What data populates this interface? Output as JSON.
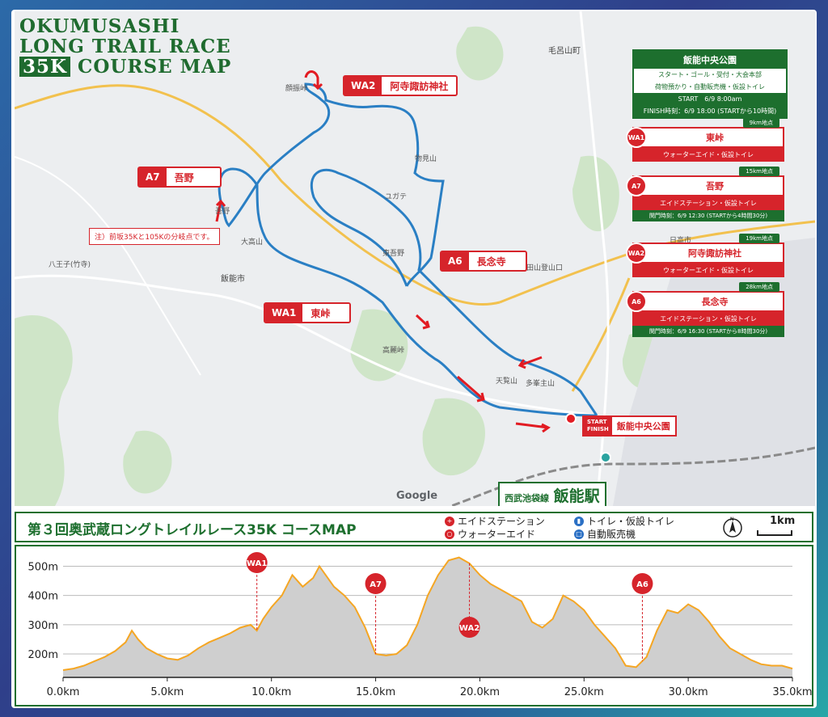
{
  "title": {
    "line1": "OKUMUSASHI",
    "line2": "LONG TRAIL RACE",
    "line3_badge": "35K",
    "line3_rest": "COURSE MAP"
  },
  "colors": {
    "accent_red": "#d6242b",
    "green": "#1d6f2e",
    "route": "#2a7fc4",
    "profile_line": "#f5a623",
    "profile_fill": "#cfcfcf"
  },
  "callouts": {
    "a7": {
      "tag": "A7",
      "name": "吾野"
    },
    "wa2": {
      "tag": "WA2",
      "name": "阿寺諏訪神社"
    },
    "a6": {
      "tag": "A6",
      "name": "長念寺"
    },
    "wa1": {
      "tag": "WA1",
      "name": "東峠"
    }
  },
  "note": "注）前坂35Kと105Kの分岐点です。",
  "start_finish": {
    "tag_line1": "START",
    "tag_line2": "FINISH",
    "name": "飯能中央公園"
  },
  "station": {
    "small": "西武池袋線",
    "big": "飯能駅"
  },
  "info_main": {
    "title": "飯能中央公園",
    "line1": "スタート・ゴール・受付・大会本部",
    "line2": "荷物預かり・自動販売機・仮設トイレ",
    "start": "START　6/9  8:00am",
    "finish": "FINISH時刻：6/9 18:00 (STARTから10時間)"
  },
  "info_items": [
    {
      "dist": "9km地点",
      "badge": "WA1",
      "name": "東峠",
      "desc": "ウォーターエイド・仮設トイレ",
      "closing": ""
    },
    {
      "dist": "15km地点",
      "badge": "A7",
      "name": "吾野",
      "desc": "エイドステーション・仮設トイレ",
      "closing": "関門時刻：6/9 12:30 (STARTから4時間30分)"
    },
    {
      "dist": "19km地点",
      "badge": "WA2",
      "name": "阿寺諏訪神社",
      "desc": "ウォーターエイド・仮設トイレ",
      "closing": ""
    },
    {
      "dist": "28km地点",
      "badge": "A6",
      "name": "長念寺",
      "desc": "エイドステーション・仮設トイレ",
      "closing": "関門時刻：6/9 16:30 (STARTから8時間30分)"
    }
  ],
  "map_labels": [
    {
      "t": "飯能市"
    },
    {
      "t": "毛呂山町"
    },
    {
      "t": "日高市"
    },
    {
      "t": "顔振峠"
    },
    {
      "t": "大高山"
    },
    {
      "t": "天覧山"
    },
    {
      "t": "多峯主山"
    },
    {
      "t": "高麗峠"
    },
    {
      "t": "日和田山登山口"
    },
    {
      "t": "物見山"
    },
    {
      "t": "ユガテ"
    },
    {
      "t": "東吾野"
    },
    {
      "t": "吾野"
    },
    {
      "t": "八王子(竹寺)"
    },
    {
      "t": "Google"
    }
  ],
  "legend": {
    "title": "第３回奥武蔵ロングトレイルレース35K コースMAP",
    "items": [
      {
        "label": "エイドステーション",
        "icon": "aid-station-icon"
      },
      {
        "label": "ウォーターエイド",
        "icon": "water-aid-icon"
      },
      {
        "label": "トイレ・仮設トイレ",
        "icon": "toilet-icon"
      },
      {
        "label": "自動販売機",
        "icon": "vending-machine-icon"
      }
    ],
    "compass": "N",
    "scale": "1km"
  },
  "chart_data": {
    "type": "area",
    "title": "",
    "xlabel": "",
    "ylabel": "",
    "xlim": [
      0,
      35
    ],
    "ylim": [
      120,
      540
    ],
    "x_ticks": [
      "0.0km",
      "5.0km",
      "10.0km",
      "15.0km",
      "20.0km",
      "25.0km",
      "30.0km",
      "35.0km"
    ],
    "y_ticks": [
      "200m",
      "300m",
      "400m",
      "500m"
    ],
    "y_tick_values": [
      200,
      300,
      400,
      500
    ],
    "grid": true,
    "series": [
      {
        "x": [
          0,
          0.5,
          1,
          1.5,
          2,
          2.5,
          3,
          3.3,
          3.6,
          4,
          4.5,
          5,
          5.5,
          6,
          6.5,
          7,
          7.5,
          8,
          8.5,
          9,
          9.3,
          9.6,
          10,
          10.5,
          11,
          11.5,
          12,
          12.3,
          12.6,
          13,
          13.5,
          14,
          14.5,
          15,
          15.5,
          16,
          16.5,
          17,
          17.5,
          18,
          18.5,
          19,
          19.5,
          20,
          20.5,
          21,
          21.5,
          22,
          22.5,
          23,
          23.5,
          24,
          24.5,
          25,
          25.5,
          26,
          26.5,
          27,
          27.5,
          28,
          28.5,
          29,
          29.5,
          30,
          30.5,
          31,
          31.5,
          32,
          32.5,
          33,
          33.5,
          34,
          34.5,
          35
        ],
        "y": [
          145,
          150,
          160,
          175,
          190,
          210,
          240,
          280,
          250,
          220,
          200,
          185,
          180,
          195,
          220,
          240,
          255,
          270,
          290,
          300,
          280,
          320,
          360,
          400,
          470,
          430,
          460,
          500,
          470,
          430,
          400,
          360,
          290,
          200,
          195,
          200,
          230,
          300,
          400,
          470,
          520,
          530,
          510,
          470,
          440,
          420,
          400,
          380,
          310,
          290,
          320,
          400,
          380,
          350,
          300,
          260,
          220,
          160,
          155,
          190,
          280,
          350,
          340,
          370,
          350,
          310,
          260,
          220,
          200,
          180,
          165,
          160,
          160,
          150
        ]
      }
    ],
    "markers": [
      {
        "label": "WA1",
        "x": 9.3
      },
      {
        "label": "A7",
        "x": 15
      },
      {
        "label": "WA2",
        "x": 19.5
      },
      {
        "label": "A6",
        "x": 27.8
      }
    ]
  }
}
